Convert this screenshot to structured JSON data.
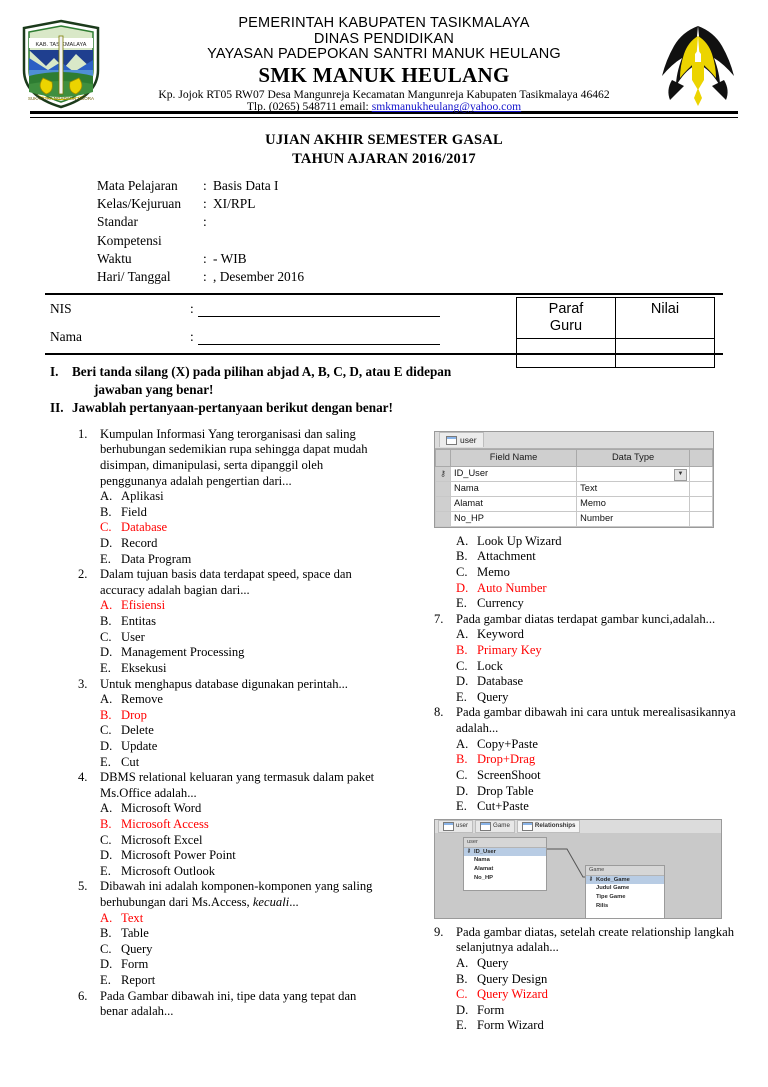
{
  "header": {
    "line1": "PEMERINTAH KABUPATEN TASIKMALAYA",
    "line2": "DINAS PENDIDIKAN",
    "line3": "YAYASAN PADEPOKAN SANTRI MANUK HEULANG",
    "school": "SMK MANUK HEULANG",
    "address": "Kp. Jojok RT05 RW07 Desa Mangunreja Kecamatan Mangunreja Kabupaten Tasikmalaya 46462",
    "tel_prefix": "Tlp. (0265) 548711 email:",
    "email": "smkmanukheulang@yahoo.com",
    "logo_left_name": "tasikmalaya-regency-emblem",
    "logo_right_name": "manuk-heulang-eagle-logo"
  },
  "title": {
    "exam": "UJIAN AKHIR SEMESTER GASAL",
    "year": "TAHUN AJARAN 2016/2017"
  },
  "meta": [
    {
      "label": "Mata Pelajaran",
      "colon": ":",
      "value": "Basis Data I"
    },
    {
      "label": "Kelas/Kejuruan",
      "colon": ":",
      "value": "XI/RPL"
    },
    {
      "label": "Standar Kompetensi",
      "colon": ":",
      "value": ""
    },
    {
      "label": "Waktu",
      "colon": ":",
      "value": "- WIB"
    },
    {
      "label": "Hari/ Tanggal",
      "colon": ":",
      "value": ",  Desember 2016"
    }
  ],
  "identity": {
    "nis_label": "NIS",
    "nama_label": "Nama",
    "colon": ":"
  },
  "paraf": {
    "col1_line1": "Paraf",
    "col1_line2": "Guru",
    "col2": "Nilai"
  },
  "instructions": [
    {
      "num": "I.",
      "text": "Beri tanda silang (X) pada pilihan abjad A, B, C, D, atau E didepan",
      "cont": "jawaban yang benar!"
    },
    {
      "num": "II.",
      "text": "Jawablah pertanyaan-pertanyaan berikut dengan benar!",
      "cont": ""
    }
  ],
  "questions_left": [
    {
      "num": "1.",
      "text": "Kumpulan Informasi Yang terorganisasi dan saling berhubungan sedemikian rupa sehingga dapat mudah disimpan, dimanipulasi, serta dipanggil oleh penggunanya adalah pengertian dari...",
      "options": [
        {
          "letter": "A.",
          "label": "Aplikasi",
          "correct": false
        },
        {
          "letter": "B.",
          "label": "Field",
          "correct": false
        },
        {
          "letter": "C.",
          "label": "Database",
          "correct": true
        },
        {
          "letter": "D.",
          "label": "Record",
          "correct": false
        },
        {
          "letter": "E.",
          "label": "Data Program",
          "correct": false
        }
      ]
    },
    {
      "num": "2.",
      "text": "Dalam tujuan basis data terdapat speed, space dan accuracy adalah bagian dari...",
      "options": [
        {
          "letter": "A.",
          "label": "Efisiensi",
          "correct": true
        },
        {
          "letter": "B.",
          "label": "Entitas",
          "correct": false
        },
        {
          "letter": "C.",
          "label": "User",
          "correct": false
        },
        {
          "letter": "D.",
          "label": "Management Processing",
          "correct": false
        },
        {
          "letter": "E.",
          "label": "Eksekusi",
          "correct": false
        }
      ]
    },
    {
      "num": "3.",
      "text": "Untuk menghapus database digunakan perintah...",
      "options": [
        {
          "letter": "A.",
          "label": "Remove",
          "correct": false
        },
        {
          "letter": "B.",
          "label": "Drop",
          "correct": true
        },
        {
          "letter": "C.",
          "label": "Delete",
          "correct": false
        },
        {
          "letter": "D.",
          "label": "Update",
          "correct": false
        },
        {
          "letter": "E.",
          "label": "Cut",
          "correct": false
        }
      ]
    },
    {
      "num": "4.",
      "text": "DBMS relational keluaran yang termasuk dalam paket Ms.Office adalah...",
      "options": [
        {
          "letter": "A.",
          "label": "Microsoft Word",
          "correct": false
        },
        {
          "letter": "B.",
          "label": "Microsoft Access",
          "correct": true
        },
        {
          "letter": "C.",
          "label": "Microsoft Excel",
          "correct": false
        },
        {
          "letter": "D.",
          "label": "Microsoft Power Point",
          "correct": false
        },
        {
          "letter": "E.",
          "label": "Microsoft Outlook",
          "correct": false
        }
      ]
    },
    {
      "num": "5.",
      "text_pre": "Dibawah ini adalah komponen-komponen yang saling berhubungan dari Ms.Access, ",
      "text_italic": "kecuali",
      "text_post": "...",
      "options": [
        {
          "letter": "A.",
          "label": "Text",
          "correct": true
        },
        {
          "letter": "B.",
          "label": "Table",
          "correct": false
        },
        {
          "letter": "C.",
          "label": "Query",
          "correct": false
        },
        {
          "letter": "D.",
          "label": "Form",
          "correct": false
        },
        {
          "letter": "E.",
          "label": "Report",
          "correct": false
        }
      ]
    },
    {
      "num": "6.",
      "text": "Pada Gambar dibawah ini, tipe data yang tepat dan benar adalah...",
      "options": []
    }
  ],
  "access_table": {
    "tab_label": "user",
    "columns": [
      "Field Name",
      "Data Type"
    ],
    "rows": [
      {
        "key": true,
        "field": "ID_User",
        "type": "",
        "has_combo": true
      },
      {
        "key": false,
        "field": "Nama",
        "type": "Text",
        "has_combo": false
      },
      {
        "key": false,
        "field": "Alamat",
        "type": "Memo",
        "has_combo": false
      },
      {
        "key": false,
        "field": "No_HP",
        "type": "Number",
        "has_combo": false
      }
    ]
  },
  "questions_right": [
    {
      "num": "",
      "text": "",
      "options": [
        {
          "letter": "A.",
          "label": "Look Up Wizard",
          "correct": false
        },
        {
          "letter": "B.",
          "label": "Attachment",
          "correct": false
        },
        {
          "letter": "C.",
          "label": "Memo",
          "correct": false
        },
        {
          "letter": "D.",
          "label": "Auto Number",
          "correct": true
        },
        {
          "letter": "E.",
          "label": "Currency",
          "correct": false
        }
      ]
    },
    {
      "num": "7.",
      "text": "Pada gambar diatas terdapat gambar kunci,adalah...",
      "options": [
        {
          "letter": "A.",
          "label": "Keyword",
          "correct": false
        },
        {
          "letter": "B.",
          "label": "Primary Key",
          "correct": true
        },
        {
          "letter": "C.",
          "label": "Lock",
          "correct": false
        },
        {
          "letter": "D.",
          "label": "Database",
          "correct": false
        },
        {
          "letter": "E.",
          "label": "Query",
          "correct": false
        }
      ]
    },
    {
      "num": "8.",
      "text": "Pada gambar dibawah ini cara untuk merealisasikannya adalah...",
      "options": [
        {
          "letter": "A.",
          "label": "Copy+Paste",
          "correct": false
        },
        {
          "letter": "B.",
          "label": "Drop+Drag",
          "correct": true
        },
        {
          "letter": "C.",
          "label": "ScreenShoot",
          "correct": false
        },
        {
          "letter": "D.",
          "label": "Drop Table",
          "correct": false
        },
        {
          "letter": "E.",
          "label": "Cut+Paste",
          "correct": false
        }
      ]
    },
    {
      "num": "9.",
      "text": "Pada gambar diatas, setelah create relationship langkah selanjutnya adalah...",
      "options": [
        {
          "letter": "A.",
          "label": "Query",
          "correct": false
        },
        {
          "letter": "B.",
          "label": "Query Design",
          "correct": false
        },
        {
          "letter": "C.",
          "label": "Query Wizard",
          "correct": true
        },
        {
          "letter": "D.",
          "label": "Form",
          "correct": false
        },
        {
          "letter": "E.",
          "label": "Form Wizard",
          "correct": false
        }
      ]
    }
  ],
  "relationships": {
    "tabs": [
      "user",
      "Game",
      "Relationships"
    ],
    "active_tab": "Relationships",
    "tables": [
      {
        "name": "user",
        "fields": [
          "ID_User",
          "Nama",
          "Alamat",
          "No_HP"
        ],
        "primary_key": "ID_User"
      },
      {
        "name": "Game",
        "fields": [
          "Kode_Game",
          "Judul Game",
          "Tipe Game",
          "Rilis"
        ],
        "primary_key": "Kode_Game"
      }
    ]
  },
  "colors": {
    "correct_answer": "#ff0000",
    "email_link": "#1414cc",
    "logo_yellow": "#ecd400",
    "logo_green": "#2e7d32"
  }
}
